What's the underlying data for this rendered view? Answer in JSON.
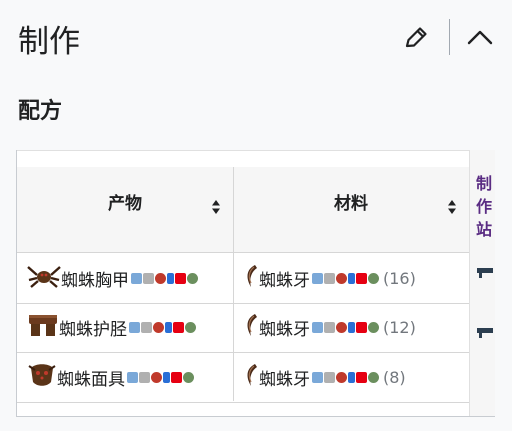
{
  "section": {
    "title": "制作",
    "edit_icon": "pencil-icon",
    "collapse_icon": "chevron-up-icon"
  },
  "recipes": {
    "title": "配方",
    "headers": {
      "product": "产物",
      "ingredients": "材料",
      "station": "制作站"
    },
    "rows": [
      {
        "product": "蜘蛛胸甲",
        "product_icon": "spider-breastplate-icon",
        "ingredient": "蜘蛛牙",
        "ingredient_icon": "spider-fang-icon",
        "count": "(16)"
      },
      {
        "product": "蜘蛛护胫",
        "product_icon": "spider-greaves-icon",
        "ingredient": "蜘蛛牙",
        "ingredient_icon": "spider-fang-icon",
        "count": "(12)"
      },
      {
        "product": "蜘蛛面具",
        "product_icon": "spider-mask-icon",
        "ingredient": "蜘蛛牙",
        "ingredient_icon": "spider-fang-icon",
        "count": "(8)"
      }
    ],
    "platforms": [
      "desktop-icon",
      "console-icon",
      "old-gen-console-icon",
      "mobile-icon",
      "switch-icon",
      "tmodloader-icon"
    ],
    "colors": {
      "accent": "#5a2c83",
      "switch": "#e60012",
      "mobile": "#2a6fd6"
    }
  }
}
